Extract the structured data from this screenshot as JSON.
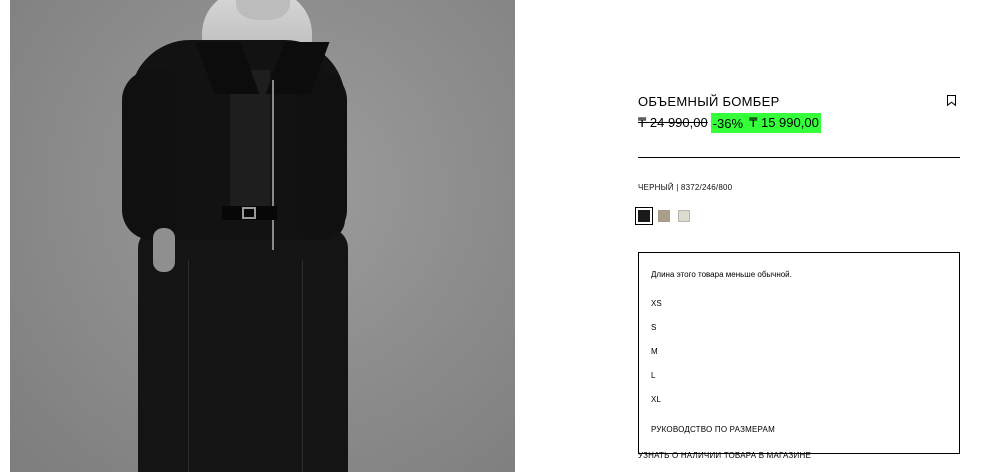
{
  "product": {
    "title": "ОБЪЕМНЫЙ БОМБЕР",
    "old_price": "₸ 24 990,00",
    "discount": "-36%",
    "new_price": "₸ 15 990,00",
    "color_ref": "ЧЕРНЫЙ | 8372/246/800",
    "discount_color": "#34ff3a"
  },
  "swatches": [
    {
      "name": "black",
      "color": "#1a1a1a",
      "selected": true
    },
    {
      "name": "taupe",
      "color": "#a99d8c",
      "selected": false
    },
    {
      "name": "cream",
      "color": "#dedbcf",
      "selected": false
    }
  ],
  "sizes": {
    "note": "Длина этого товара меньше обычной.",
    "items": [
      "XS",
      "S",
      "M",
      "L",
      "XL"
    ],
    "guide_label": "РУКОВОДСТВО ПО РАЗМЕРАМ"
  },
  "store_link": "УЗНАТЬ О НАЛИЧИИ ТОВАРА В МАГАЗИНЕ",
  "icons": {
    "bookmark": "bookmark-icon"
  }
}
